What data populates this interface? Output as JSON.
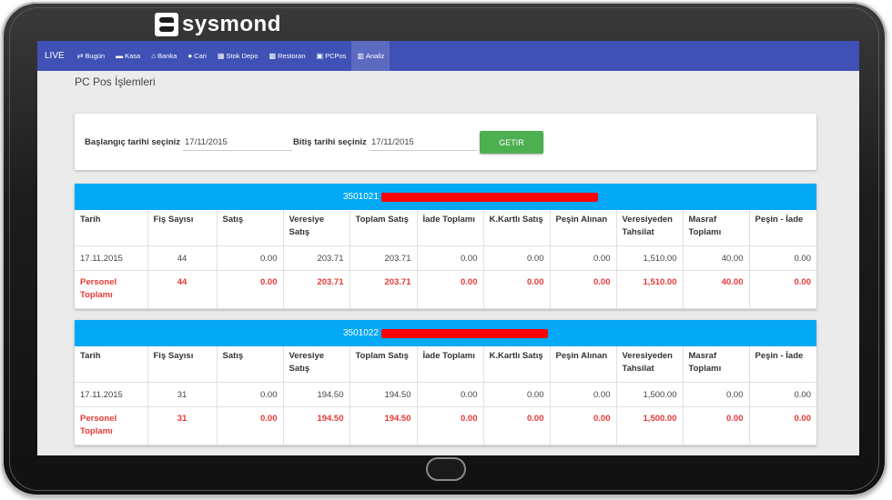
{
  "brand": {
    "logo_text": "sysmond"
  },
  "navbar": {
    "live": "LIVE",
    "items": [
      {
        "label": "Bugün",
        "icon": "⇄",
        "icon_name": "exchange-icon"
      },
      {
        "label": "Kasa",
        "icon": "▬",
        "icon_name": "cash-icon"
      },
      {
        "label": "Banka",
        "icon": "⌂",
        "icon_name": "bank-icon"
      },
      {
        "label": "Cari",
        "icon": "●",
        "icon_name": "user-icon"
      },
      {
        "label": "Stok Depo",
        "icon": "▦",
        "icon_name": "stock-icon"
      },
      {
        "label": "Restoran",
        "icon": "▩",
        "icon_name": "restaurant-icon"
      },
      {
        "label": "PCPos",
        "icon": "▣",
        "icon_name": "pcpos-icon"
      },
      {
        "label": "Analiz",
        "icon": "▥",
        "icon_name": "analysis-icon",
        "active": true
      }
    ]
  },
  "page": {
    "title": "PC Pos İşlemleri"
  },
  "filter": {
    "start_label": "Başlangıç tarihi seçiniz",
    "start_value": "17/11/2015",
    "end_label": "Bitiş tarihi seçiniz",
    "end_value": "17/11/2015",
    "button_label": "GETIR"
  },
  "columns": [
    "Tarih",
    "Fiş Sayısı",
    "Satış",
    "Veresiye Satış",
    "Toplam Satış",
    "İade Toplamı",
    "K.Kartlı Satış",
    "Peşin Alınan",
    "Veresiyeden Tahsilat",
    "Masraf Toplamı",
    "Peşin - İade"
  ],
  "colors": {
    "accent": "#3f51b5",
    "card_header": "#03a9f4",
    "button": "#4caf50",
    "total_text": "#e53935"
  },
  "cards": [
    {
      "code": "3501021",
      "row": [
        "17.11.2015",
        "44",
        "0.00",
        "203.71",
        "203.71",
        "0.00",
        "0.00",
        "0.00",
        "1,510.00",
        "40.00",
        "0.00"
      ],
      "total": [
        "Personel Toplamı",
        "44",
        "0.00",
        "203.71",
        "203.71",
        "0.00",
        "0.00",
        "0.00",
        "1,510.00",
        "40.00",
        "0.00"
      ]
    },
    {
      "code": "3501022",
      "row": [
        "17.11.2015",
        "31",
        "0.00",
        "194.50",
        "194.50",
        "0.00",
        "0.00",
        "0.00",
        "1,500.00",
        "0.00",
        "0.00"
      ],
      "total": [
        "Personel Toplamı",
        "31",
        "0.00",
        "194.50",
        "194.50",
        "0.00",
        "0.00",
        "0.00",
        "1,500.00",
        "0.00",
        "0.00"
      ]
    }
  ]
}
